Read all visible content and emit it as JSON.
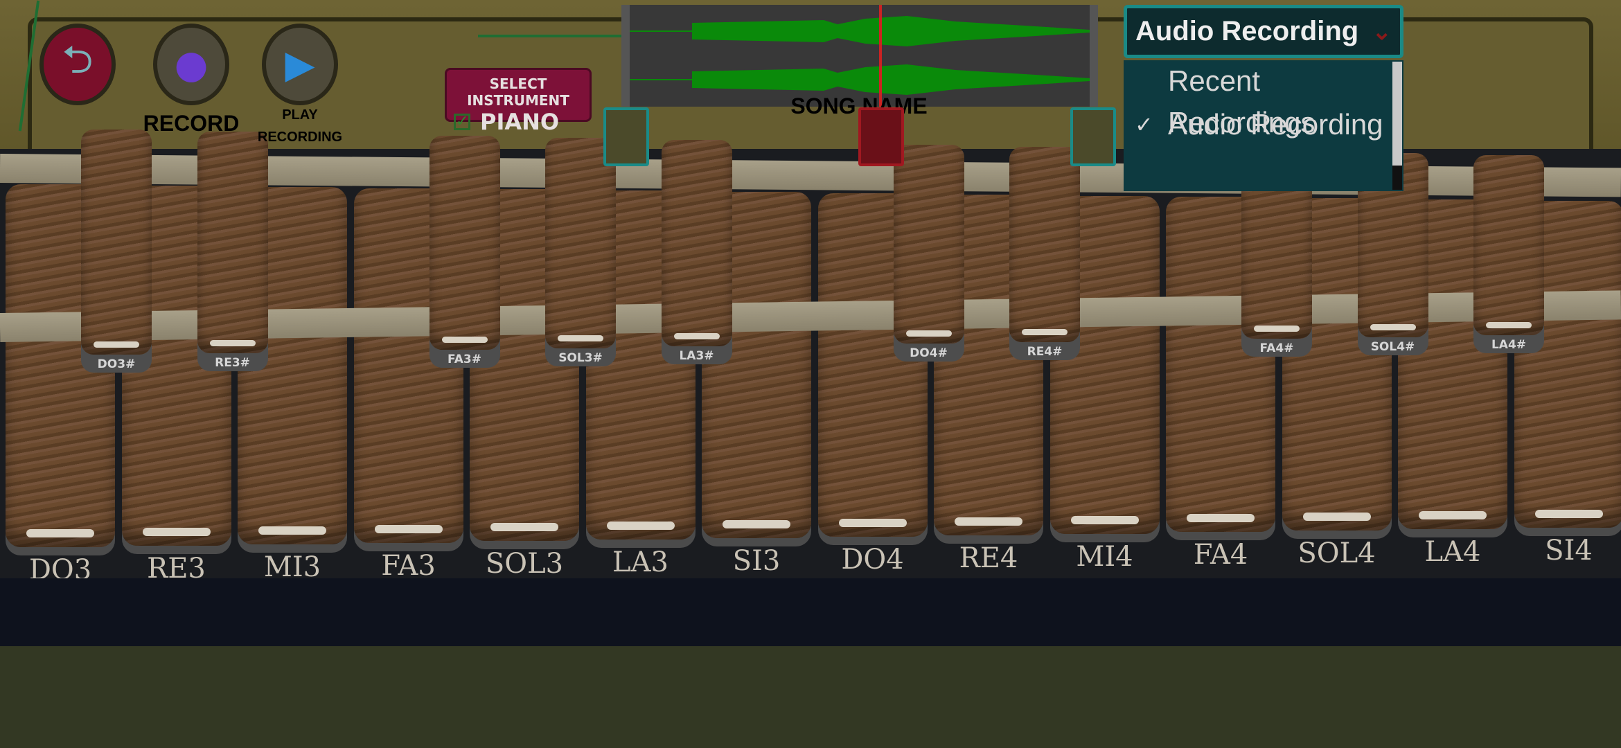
{
  "header": {
    "back_button": {
      "icon": "back-arrow-icon"
    },
    "record_button": {
      "label": "RECORD",
      "icon": "purple-gem-record-icon"
    },
    "play_button": {
      "label_line1": "PLAY",
      "label_line2": "RECORDING",
      "icon": "blue-gem-play-icon"
    },
    "instrument_selector": {
      "title": "SELECT INSTRUMENT",
      "value": "PIANO",
      "checked": true
    }
  },
  "waveform": {
    "song_name": "SONG NAME",
    "wave_color": "#0a8a0a",
    "playhead_color": "#cc2222"
  },
  "dropdown": {
    "selected": "Audio Recording",
    "options": [
      {
        "label": "Recent Recordings",
        "checked": false
      },
      {
        "label": "Audio Recording",
        "checked": true
      }
    ]
  },
  "keys": {
    "naturals": [
      "DO3",
      "RE3",
      "MI3",
      "FA3",
      "SOL3",
      "LA3",
      "SI3",
      "DO4",
      "RE4",
      "MI4",
      "FA4",
      "SOL4",
      "LA4",
      "SI4"
    ],
    "sharps": [
      {
        "label": "DO3#",
        "after": 0
      },
      {
        "label": "RE3#",
        "after": 1
      },
      {
        "label": "FA3#",
        "after": 3
      },
      {
        "label": "SOL3#",
        "after": 4
      },
      {
        "label": "LA3#",
        "after": 5
      },
      {
        "label": "DO4#",
        "after": 7
      },
      {
        "label": "RE4#",
        "after": 8
      },
      {
        "label": "FA4#",
        "after": 10
      },
      {
        "label": "SOL4#",
        "after": 11
      },
      {
        "label": "LA4#",
        "after": 12
      }
    ]
  }
}
